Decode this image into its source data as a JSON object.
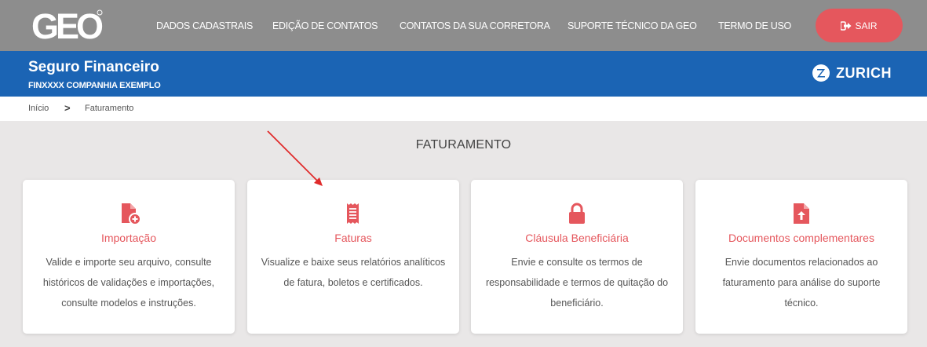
{
  "header": {
    "logo_text": "GEO",
    "nav": [
      "DADOS CADASTRAIS",
      "EDIÇÃO DE CONTATOS",
      "CONTATOS DA SUA CORRETORA",
      "SUPORTE TÉCNICO DA GEO",
      "TERMO DE USO"
    ],
    "logout_label": "SAIR",
    "logout_icon": "sign-out-icon"
  },
  "product": {
    "title": "Seguro Financeiro",
    "company": "FINXXXX COMPANHIA EXEMPLO",
    "insurer": "ZURICH"
  },
  "breadcrumb": {
    "home": "Início",
    "separator": ">",
    "current": "Faturamento"
  },
  "section_title": "FATURAMENTO",
  "cards": [
    {
      "title": "Importação",
      "icon": "file-plus-icon",
      "description": "Valide e importe seu arquivo, consulte históricos de validações e importações, consulte modelos e instruções."
    },
    {
      "title": "Faturas",
      "icon": "receipt-icon",
      "description": "Visualize e baixe seus relatórios analíticos de fatura, boletos e certificados."
    },
    {
      "title": "Cláusula Beneficiária",
      "icon": "lock-icon",
      "description": "Envie e consulte os termos de responsabilidade e termos de quitação do beneficiário."
    },
    {
      "title": "Documentos complementares",
      "icon": "file-upload-icon",
      "description": "Envie documentos relacionados ao faturamento para análise do suporte técnico."
    }
  ],
  "colors": {
    "topbar": "#8d8d8d",
    "band": "#1b64b4",
    "accent": "#e5575d",
    "background": "#e9e7e7",
    "annotation_arrow": "#e02b2b"
  }
}
